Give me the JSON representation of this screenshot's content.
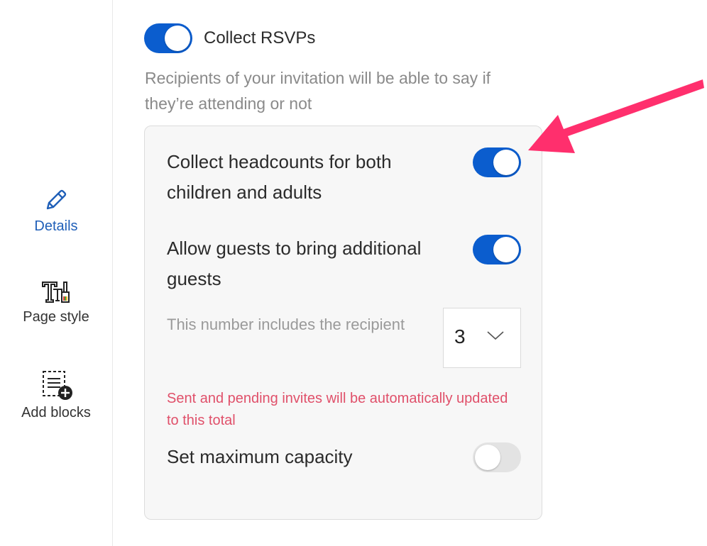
{
  "sidebar": {
    "items": [
      {
        "label": "Details",
        "icon": "pencil-icon",
        "active": true
      },
      {
        "label": "Page style",
        "icon": "text-style-icon",
        "active": false
      },
      {
        "label": "Add blocks",
        "icon": "add-blocks-icon",
        "active": false
      }
    ]
  },
  "rsvp": {
    "toggle_label": "Collect RSVPs",
    "enabled": true,
    "description": "Recipients of your invitation will be able to say if they’re attending or not"
  },
  "settings": {
    "headcounts": {
      "label": "Collect headcounts for both children and adults",
      "enabled": true
    },
    "additional_guests": {
      "label": "Allow guests to bring additional guests",
      "enabled": true,
      "hint": "This number includes the recipient",
      "selected_value": "3",
      "warning": "Sent and pending invites will be automatically updated to this total"
    },
    "max_capacity": {
      "label": "Set maximum capacity",
      "enabled": false
    }
  },
  "colors": {
    "accent": "#0b5dce",
    "active_nav": "#1f5fb8",
    "warning": "#e0506a",
    "annotation_arrow": "#ff2f6d"
  }
}
